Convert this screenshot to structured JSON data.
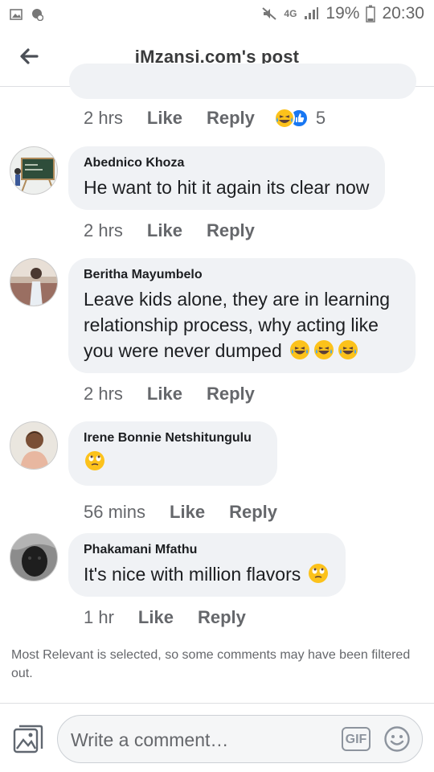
{
  "status_bar": {
    "network": "4G",
    "battery": "19%",
    "time": "20:30"
  },
  "header": {
    "title": "iMzansi.com's post"
  },
  "previous_comment_actions": {
    "time": "2 hrs",
    "like": "Like",
    "reply": "Reply",
    "reaction_count": "5"
  },
  "comments": [
    {
      "author": "Abednico Khoza",
      "text": "He want to hit it again its clear now",
      "time": "2 hrs",
      "like": "Like",
      "reply": "Reply"
    },
    {
      "author": "Beritha Mayumbelo",
      "text": "Leave kids alone, they are in learning relationship process, why acting like you were never dumped",
      "time": "2 hrs",
      "like": "Like",
      "reply": "Reply"
    },
    {
      "author": "Irene Bonnie Netshitungulu",
      "text": "",
      "time": "56 mins",
      "like": "Like",
      "reply": "Reply"
    },
    {
      "author": "Phakamani Mfathu",
      "text": "It's nice with million flavors",
      "time": "1 hr",
      "like": "Like",
      "reply": "Reply"
    }
  ],
  "filter_note": "Most Relevant is selected, so some comments may have been filtered out.",
  "composer": {
    "placeholder": "Write a comment…",
    "gif_label": "GIF"
  },
  "icons": {
    "back": "back-arrow-icon",
    "photo": "photo-icon",
    "smile": "smiley-icon",
    "laugh_cry": "tears-of-joy-emoji",
    "eye_roll": "eye-roll-emoji"
  }
}
